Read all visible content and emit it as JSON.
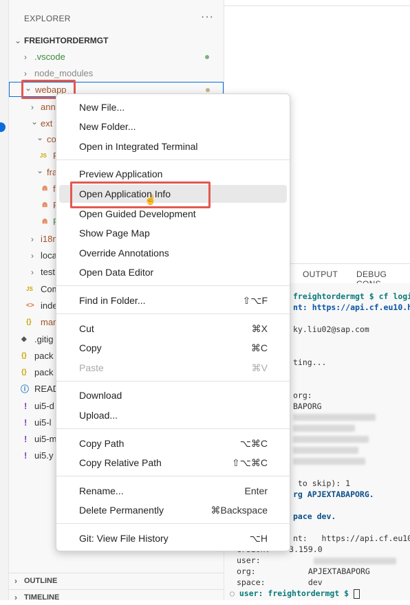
{
  "explorer": {
    "title": "EXPLORER",
    "more": "···",
    "root": "FREIGHTORDERMGT",
    "rows": [
      {
        "label": ".vscode",
        "color": "#3c8a3c",
        "chev": "›",
        "dot": "#7bb37b"
      },
      {
        "label": "node_modules",
        "color": "#888888",
        "chev": "›"
      },
      {
        "label": "webapp",
        "color": "#a0522d",
        "chev": "⌄",
        "dot": "#c4b48a"
      },
      {
        "label": "ann",
        "color": "#a0522d",
        "chev": "›"
      },
      {
        "label": "ext",
        "color": "#a0522d",
        "chev": "⌄"
      },
      {
        "label": "co",
        "color": "#a0522d",
        "chev": "⌄"
      },
      {
        "label": "JS",
        "color": "#a0522d",
        "chev": ""
      },
      {
        "label": "fra",
        "color": "#a0522d",
        "chev": "⌄"
      },
      {
        "label": "f",
        "color": "#a0522d",
        "chev": ""
      },
      {
        "label": "F",
        "color": "#a0522d",
        "chev": ""
      },
      {
        "label": "F",
        "color": "#3c8a3c",
        "chev": ""
      },
      {
        "label": "i18n",
        "color": "#a0522d",
        "chev": "›"
      },
      {
        "label": "loca",
        "color": "#333333",
        "chev": "›"
      },
      {
        "label": "test",
        "color": "#333333",
        "chev": "›"
      },
      {
        "label": "Com",
        "color": "#333333",
        "chev": ""
      },
      {
        "label": "inde",
        "color": "#333333",
        "chev": ""
      },
      {
        "label": "man",
        "color": "#a0522d",
        "chev": ""
      },
      {
        "label": ".gitig",
        "color": "#333333",
        "chev": ""
      },
      {
        "label": "pack",
        "color": "#333333",
        "chev": ""
      },
      {
        "label": "pack",
        "color": "#333333",
        "chev": ""
      },
      {
        "label": "READ",
        "color": "#333333",
        "chev": ""
      },
      {
        "label": "ui5-d",
        "color": "#333333",
        "chev": ""
      },
      {
        "label": "ui5-l",
        "color": "#333333",
        "chev": ""
      },
      {
        "label": "ui5-m",
        "color": "#333333",
        "chev": ""
      },
      {
        "label": "ui5.y",
        "color": "#333333",
        "chev": ""
      }
    ],
    "outline": "OUTLINE",
    "timeline": "TIMELINE"
  },
  "panel": {
    "tabs": [
      "OUTPUT",
      "DEBUG CONS"
    ],
    "terminal": [
      {
        "text": "freightordermgt $ cf login",
        "kind": "prompt"
      },
      {
        "text": "nt: https://api.cf.eu10.h",
        "kind": "endpoint"
      },
      {
        "text": "ky.liu02@sap.com",
        "kind": "plain"
      },
      {
        "text": "ting...",
        "kind": "plain"
      },
      {
        "text": "org:",
        "kind": "plain"
      },
      {
        "text": "BAPORG",
        "kind": "plain"
      },
      {
        "text": " to skip): 1",
        "kind": "plain"
      },
      {
        "text": "rg APJEXTABAPORG.",
        "kind": "orgbold"
      },
      {
        "text": "pace dev.",
        "kind": "spacebold"
      },
      {
        "text": "nt:   https://api.cf.eu10",
        "kind": "plain"
      },
      {
        "text": "ersion:    3.159.0",
        "kind": "plain"
      },
      {
        "text": "user:",
        "kind": "plain"
      },
      {
        "text": "org:           APJEXTABAPORG",
        "kind": "plain"
      },
      {
        "text": "space:         dev",
        "kind": "plain"
      },
      {
        "text": "user: freightordermgt $ ",
        "kind": "finalprompt"
      }
    ]
  },
  "context_menu": {
    "items": [
      {
        "label": "New File...",
        "key": ""
      },
      {
        "label": "New Folder...",
        "key": ""
      },
      {
        "label": "Open in Integrated Terminal",
        "key": ""
      },
      {
        "label": "Preview Application",
        "key": ""
      },
      {
        "label": "Open Application Info",
        "key": ""
      },
      {
        "label": "Open Guided Development",
        "key": ""
      },
      {
        "label": "Show Page Map",
        "key": ""
      },
      {
        "label": "Override Annotations",
        "key": ""
      },
      {
        "label": "Open Data Editor",
        "key": ""
      },
      {
        "label": "Find in Folder...",
        "key": "⇧⌥F"
      },
      {
        "label": "Cut",
        "key": "⌘X"
      },
      {
        "label": "Copy",
        "key": "⌘C"
      },
      {
        "label": "Paste",
        "key": "⌘V"
      },
      {
        "label": "Download",
        "key": ""
      },
      {
        "label": "Upload...",
        "key": ""
      },
      {
        "label": "Copy Path",
        "key": "⌥⌘C"
      },
      {
        "label": "Copy Relative Path",
        "key": "⇧⌥⌘C"
      },
      {
        "label": "Rename...",
        "key": "Enter"
      },
      {
        "label": "Delete Permanently",
        "key": "⌘Backspace"
      },
      {
        "label": "Git: View File History",
        "key": "⌥H"
      }
    ]
  },
  "colors": {
    "highlight_box": "#e3584f",
    "selection_border": "#0a6dd9",
    "link_blue": "#0a55a6",
    "prompt_teal": "#0b7a7a"
  }
}
